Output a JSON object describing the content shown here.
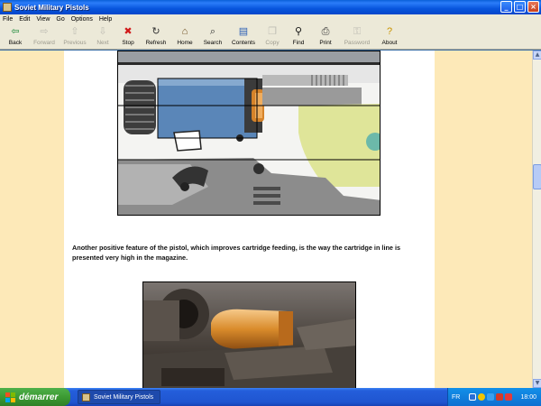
{
  "window": {
    "title": "Soviet Military Pistols"
  },
  "menu": [
    "File",
    "Edit",
    "View",
    "Go",
    "Options",
    "Help"
  ],
  "toolbar": [
    {
      "label": "Back",
      "icon": "back-arrow-icon",
      "glyph": "⇦",
      "color": "#1d8a3a",
      "enabled": true
    },
    {
      "label": "Forward",
      "icon": "forward-arrow-icon",
      "glyph": "⇨",
      "color": "#888",
      "enabled": false
    },
    {
      "label": "Previous",
      "icon": "up-arrow-icon",
      "glyph": "⇧",
      "color": "#888",
      "enabled": false
    },
    {
      "label": "Next",
      "icon": "down-arrow-icon",
      "glyph": "⇩",
      "color": "#888",
      "enabled": false
    },
    {
      "label": "Stop",
      "icon": "stop-icon",
      "glyph": "✖",
      "color": "#d11a1a",
      "enabled": true
    },
    {
      "label": "Refresh",
      "icon": "refresh-icon",
      "glyph": "↻",
      "color": "#333",
      "enabled": true
    },
    {
      "label": "Home",
      "icon": "home-icon",
      "glyph": "⌂",
      "color": "#6b4a1a",
      "enabled": true
    },
    {
      "label": "Search",
      "icon": "search-icon",
      "glyph": "⌕",
      "color": "#333",
      "enabled": true
    },
    {
      "label": "Contents",
      "icon": "contents-icon",
      "glyph": "▤",
      "color": "#2b5fb5",
      "enabled": true
    },
    {
      "label": "Copy",
      "icon": "copy-icon",
      "glyph": "❐",
      "color": "#888",
      "enabled": false
    },
    {
      "label": "Find",
      "icon": "binoculars-icon",
      "glyph": "⚲",
      "color": "#111",
      "enabled": true
    },
    {
      "label": "Print",
      "icon": "printer-icon",
      "glyph": "⎙",
      "color": "#333",
      "enabled": true
    },
    {
      "label": "Password",
      "icon": "key-icon",
      "glyph": "⚿",
      "color": "#888",
      "enabled": false
    },
    {
      "label": "About",
      "icon": "help-icon",
      "glyph": "?",
      "color": "#c99400",
      "enabled": true
    }
  ],
  "content": {
    "paragraph": "Another positive feature of the pistol, which improves cartridge feeding, is the way the cartridge in line is presented very high in the magazine.",
    "background": "#fde9b8"
  },
  "taskbar": {
    "start_label": "démarrer",
    "task_label": "Soviet Military Pistols",
    "language": "FR",
    "clock": "18:00"
  }
}
